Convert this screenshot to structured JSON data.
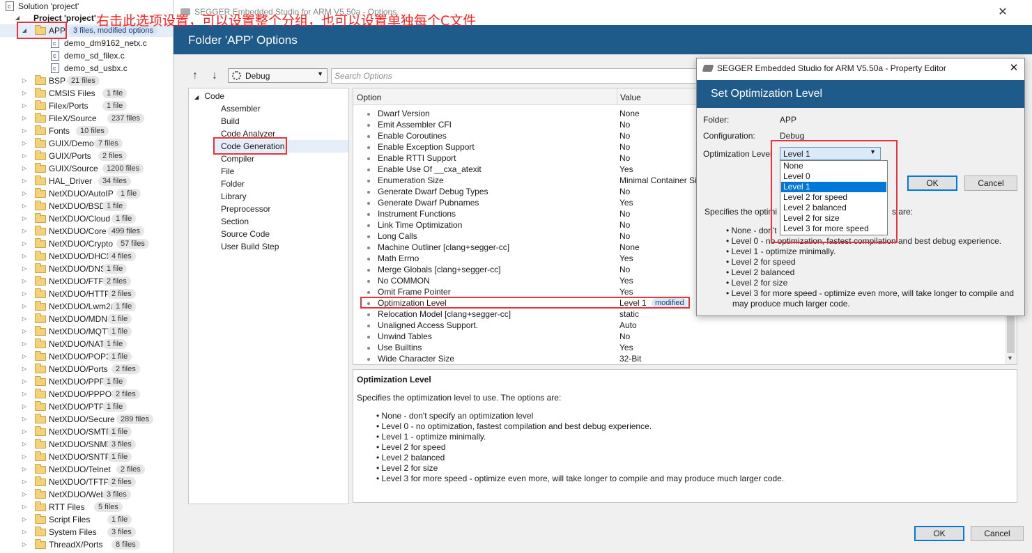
{
  "tree": {
    "solution": "Solution 'project'",
    "project": "Project 'project'",
    "app_folder": {
      "name": "APP",
      "badge": "3 files, modified options"
    },
    "app_files": [
      "demo_dm9162_netx.c",
      "demo_sd_filex.c",
      "demo_sd_usbx.c"
    ],
    "folders": [
      {
        "name": "BSP",
        "badge": "21 files"
      },
      {
        "name": "CMSIS Files",
        "badge": "1 file"
      },
      {
        "name": "Filex/Ports",
        "badge": "1 file"
      },
      {
        "name": "FileX/Source",
        "badge": "237 files"
      },
      {
        "name": "Fonts",
        "badge": "10 files"
      },
      {
        "name": "GUIX/Demo",
        "badge": "7 files"
      },
      {
        "name": "GUIX/Ports",
        "badge": "2 files"
      },
      {
        "name": "GUIX/Source",
        "badge": "1200 files"
      },
      {
        "name": "HAL_Driver",
        "badge": "34 files"
      },
      {
        "name": "NetXDUO/AutoIP",
        "badge": "1 file"
      },
      {
        "name": "NetXDUO/BSD",
        "badge": "1 file"
      },
      {
        "name": "NetXDUO/Cloud",
        "badge": "1 file"
      },
      {
        "name": "NetXDUO/Core",
        "badge": "499 files"
      },
      {
        "name": "NetXDUO/Crypto",
        "badge": "57 files"
      },
      {
        "name": "NetXDUO/DHCP",
        "badge": "4 files"
      },
      {
        "name": "NetXDUO/DNS",
        "badge": "1 file"
      },
      {
        "name": "NetXDUO/FTP",
        "badge": "2 files"
      },
      {
        "name": "NetXDUO/HTTP",
        "badge": "2 files"
      },
      {
        "name": "NetXDUO/Lwm2m",
        "badge": "1 file"
      },
      {
        "name": "NetXDUO/MDNS",
        "badge": "1 file"
      },
      {
        "name": "NetXDUO/MQTT",
        "badge": "1 file"
      },
      {
        "name": "NetXDUO/NAT",
        "badge": "1 file"
      },
      {
        "name": "NetXDUO/POP3",
        "badge": "1 file"
      },
      {
        "name": "NetXDUO/Ports",
        "badge": "2 files"
      },
      {
        "name": "NetXDUO/PPP",
        "badge": "1 file"
      },
      {
        "name": "NetXDUO/PPPOE",
        "badge": "2 files"
      },
      {
        "name": "NetXDUO/PTP",
        "badge": "1 file"
      },
      {
        "name": "NetXDUO/Secure",
        "badge": "289 files"
      },
      {
        "name": "NetXDUO/SMTP",
        "badge": "1 file"
      },
      {
        "name": "NetXDUO/SNMP",
        "badge": "3 files"
      },
      {
        "name": "NetXDUO/SNTP",
        "badge": "1 file"
      },
      {
        "name": "NetXDUO/Telnet",
        "badge": "2 files"
      },
      {
        "name": "NetXDUO/TFTP",
        "badge": "2 files"
      },
      {
        "name": "NetXDUO/Web",
        "badge": "3 files"
      },
      {
        "name": "RTT Files",
        "badge": "5 files"
      },
      {
        "name": "Script Files",
        "badge": "1 file"
      },
      {
        "name": "System Files",
        "badge": "3 files"
      },
      {
        "name": "ThreadX/Ports",
        "badge": "8 files"
      }
    ]
  },
  "annotation": "右击此选项设置，可以设置整个分组，也可以设置单独每个C文件",
  "window": {
    "title": "SEGGER Embedded Studio for ARM V5.50a - Options",
    "close": "✕",
    "header": "Folder 'APP' Options",
    "config": "Debug",
    "search_placeholder": "Search Options",
    "categories": [
      "Code",
      "Assembler",
      "Build",
      "Code Analyzer",
      "Code Generation",
      "Compiler",
      "File",
      "Folder",
      "Library",
      "Preprocessor",
      "Section",
      "Source Code",
      "User Build Step"
    ],
    "columns": {
      "option": "Option",
      "value": "Value"
    },
    "options": [
      {
        "name": "Dwarf Version",
        "value": "None"
      },
      {
        "name": "Emit Assembler CFI",
        "value": "No"
      },
      {
        "name": "Enable Coroutines",
        "value": "No"
      },
      {
        "name": "Enable Exception Support",
        "value": "No"
      },
      {
        "name": "Enable RTTI Support",
        "value": "No"
      },
      {
        "name": "Enable Use Of __cxa_atexit",
        "value": "Yes"
      },
      {
        "name": "Enumeration Size",
        "value": "Minimal Container Size"
      },
      {
        "name": "Generate Dwarf Debug Types",
        "value": "No"
      },
      {
        "name": "Generate Dwarf Pubnames",
        "value": "Yes"
      },
      {
        "name": "Instrument Functions",
        "value": "No"
      },
      {
        "name": "Link Time Optimization",
        "value": "No"
      },
      {
        "name": "Long Calls",
        "value": "No"
      },
      {
        "name": "Machine Outliner [clang+segger-cc]",
        "value": "None"
      },
      {
        "name": "Math Errno",
        "value": "Yes"
      },
      {
        "name": "Merge Globals [clang+segger-cc]",
        "value": "No"
      },
      {
        "name": "No COMMON",
        "value": "Yes"
      },
      {
        "name": "Omit Frame Pointer",
        "value": "Yes"
      },
      {
        "name": "Optimization Level",
        "value": "Level 1",
        "badge": "modified"
      },
      {
        "name": "Relocation Model [clang+segger-cc]",
        "value": "static"
      },
      {
        "name": "Unaligned Access Support.",
        "value": "Auto"
      },
      {
        "name": "Unwind Tables",
        "value": "No"
      },
      {
        "name": "Use Builtins",
        "value": "Yes"
      },
      {
        "name": "Wide Character Size",
        "value": "32-Bit"
      }
    ],
    "description": {
      "title": "Optimization Level",
      "intro": "Specifies the optimization level to use. The options are:",
      "items": [
        "• None - don't specify an optimization level",
        "• Level 0 - no optimization, fastest compilation and best debug experience.",
        "• Level 1 - optimize minimally.",
        "• Level 2 for speed",
        "• Level 2 balanced",
        "• Level 2 for size",
        "• Level 3 for more speed - optimize even more, will take longer to compile and may produce much larger code."
      ]
    },
    "ok": "OK",
    "cancel": "Cancel"
  },
  "dialog": {
    "title": "SEGGER Embedded Studio for ARM V5.50a - Property Editor",
    "close": "✕",
    "header": "Set Optimization Level",
    "folder_label": "Folder:",
    "folder_value": "APP",
    "config_label": "Configuration:",
    "config_value": "Debug",
    "level_label": "Optimization Level",
    "level_value": "Level 1",
    "level_options": [
      "None",
      "Level 0",
      "Level 1",
      "Level 2 for speed",
      "Level 2 balanced",
      "Level 2 for size",
      "Level 3 for more speed"
    ],
    "ok": "OK",
    "cancel": "Cancel",
    "desc_intro_head": "Specifies the optimi",
    "desc_intro_tail": "s are:",
    "desc_items": [
      "• None - don't",
      "• Level 0 - no optimization, fastest compilation and best debug experience.",
      "• Level 1 - optimize minimally.",
      "• Level 2 for speed",
      "• Level 2 balanced",
      "• Level 2 for size",
      "• Level 3 for more speed - optimize even more, will take longer to compile and",
      "may produce much larger code."
    ]
  }
}
